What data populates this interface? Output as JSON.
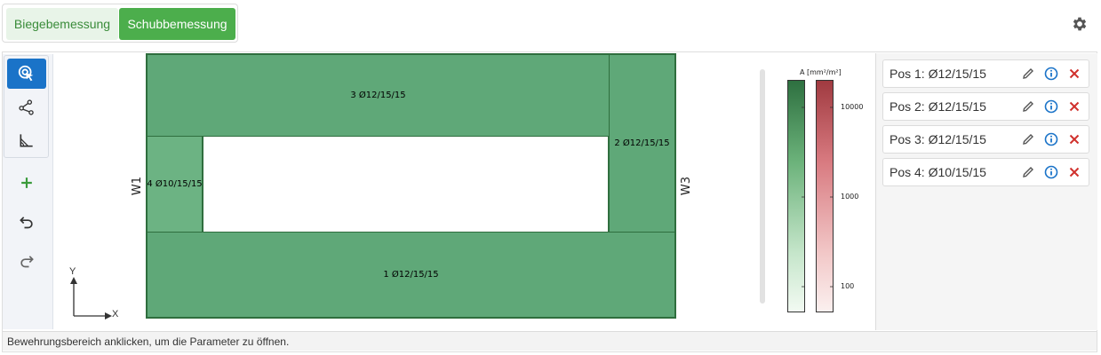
{
  "tabs": [
    {
      "label": "Biegebemessung",
      "active": false
    },
    {
      "label": "Schubbemessung",
      "active": true
    }
  ],
  "header": {
    "settings_icon": "gear-icon"
  },
  "toolbar": {
    "tools": [
      "select-cursor-icon",
      "polyline-nodes-icon",
      "angle-measure-icon"
    ],
    "actions": [
      "add-icon",
      "undo-icon",
      "redo-icon"
    ]
  },
  "drawing": {
    "regions": [
      {
        "label": "3 Ø12/15/15"
      },
      {
        "label": "2 Ø12/15/15"
      },
      {
        "label": "4 Ø10/15/15"
      },
      {
        "label": "1 Ø12/15/15"
      }
    ],
    "walls": {
      "left": "W1",
      "right": "W3"
    },
    "axes": {
      "x": "X",
      "y": "Y"
    },
    "fill_color": "#5fa878",
    "outline_color": "#2f6e3e"
  },
  "legend": {
    "title": "A [mm²/m²]",
    "ticks": [
      "10000",
      "1000",
      "100"
    ],
    "scale": "log",
    "colors": {
      "green_top": "#2e7040",
      "red_top": "#a03a40"
    }
  },
  "positions": [
    {
      "label": "Pos 1: Ø12/15/15"
    },
    {
      "label": "Pos 2: Ø12/15/15"
    },
    {
      "label": "Pos 3: Ø12/15/15"
    },
    {
      "label": "Pos 4: Ø10/15/15"
    }
  ],
  "status": {
    "text": "Bewehrungsbereich anklicken, um die Parameter zu öffnen."
  }
}
